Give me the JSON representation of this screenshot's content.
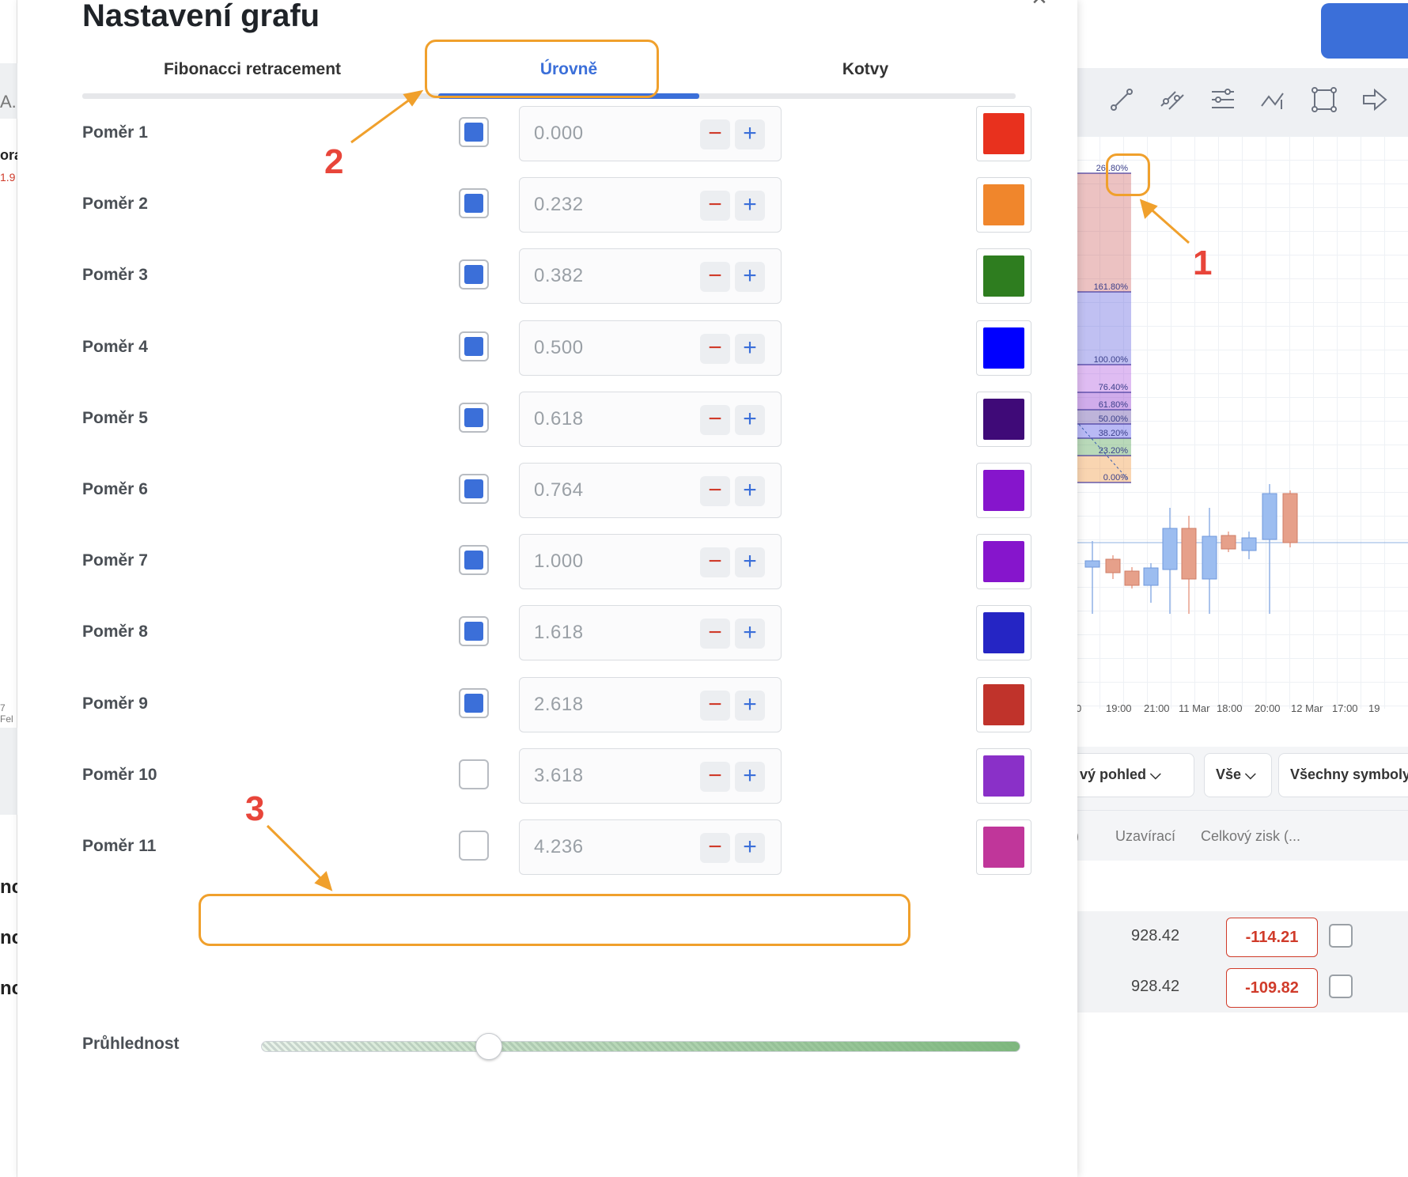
{
  "modal": {
    "title": "Nastavení grafu",
    "close_icon": "close-icon",
    "tabs": [
      {
        "label": "Fibonacci retracement",
        "active": false
      },
      {
        "label": "Úrovně",
        "active": true
      },
      {
        "label": "Kotvy",
        "active": false
      }
    ],
    "levels": [
      {
        "label": "Poměr 1",
        "checked": true,
        "value": "0.000",
        "color": "#e8311e"
      },
      {
        "label": "Poměr 2",
        "checked": true,
        "value": "0.232",
        "color": "#f0862c"
      },
      {
        "label": "Poměr 3",
        "checked": true,
        "value": "0.382",
        "color": "#2e7d1f"
      },
      {
        "label": "Poměr 4",
        "checked": true,
        "value": "0.500",
        "color": "#0000ff"
      },
      {
        "label": "Poměr 5",
        "checked": true,
        "value": "0.618",
        "color": "#3f0a78"
      },
      {
        "label": "Poměr 6",
        "checked": true,
        "value": "0.764",
        "color": "#8615cc"
      },
      {
        "label": "Poměr 7",
        "checked": true,
        "value": "1.000",
        "color": "#8615cc"
      },
      {
        "label": "Poměr 8",
        "checked": true,
        "value": "1.618",
        "color": "#2525c4"
      },
      {
        "label": "Poměr 9",
        "checked": true,
        "value": "2.618",
        "color": "#c0332b"
      },
      {
        "label": "Poměr 10",
        "checked": false,
        "value": "3.618",
        "color": "#8a30c8"
      },
      {
        "label": "Poměr 11",
        "checked": false,
        "value": "4.236",
        "color": "#c0369a"
      }
    ],
    "minus_symbol": "−",
    "plus_symbol": "+",
    "opacity": {
      "label": "Průhlednost",
      "value_fraction": 0.3
    }
  },
  "annotations": {
    "one": "1",
    "two": "2",
    "three": "3"
  },
  "background": {
    "left_fragments": {
      "a": "A.",
      "b": "ora",
      "c": "1.9",
      "d": "7 Fel",
      "e": "nc",
      "f": "nc",
      "g": "nc"
    },
    "chart": {
      "fib_labels": [
        "26 .80%",
        "161.80%",
        "100.00%",
        "76.40%",
        "61.80%",
        "50.00%",
        "38.20%",
        "23.20%",
        "0.00%"
      ],
      "time_labels": [
        "0",
        "19:00",
        "21:00",
        "11 Mar",
        "18:00",
        "20:00",
        "12 Mar",
        "17:00",
        "19"
      ]
    },
    "filters": {
      "view": "vý pohled",
      "all": "Vše",
      "symbols": "Všechny symboly"
    },
    "columns": {
      "c0": ")",
      "close": "Uzavírací",
      "profit": "Celkový zisk (..."
    },
    "rows": [
      {
        "value": "928.42",
        "pl": "-114.21"
      },
      {
        "value": "928.42",
        "pl": "-109.82"
      }
    ],
    "accent": "#3b6fd9"
  }
}
